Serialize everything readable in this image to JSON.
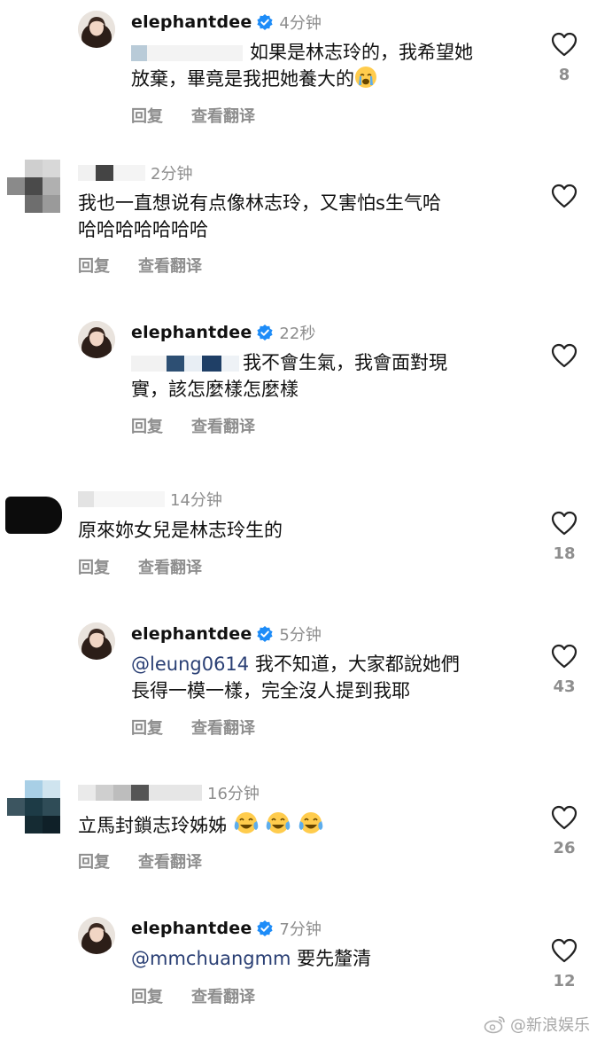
{
  "comments": [
    {
      "username": "elephantdee",
      "time": "4分钟",
      "text_line1": "如果是林志玲的，我希望她",
      "text_line2": "放棄，畢竟是我把她養大的",
      "reply": "回复",
      "translate": "查看翻译",
      "likes": "8"
    },
    {
      "username": "",
      "time": "2分钟",
      "text_line1": "我也一直想说有点像林志玲，又害怕s生气哈",
      "text_line2": "哈哈哈哈哈哈哈",
      "reply": "回复",
      "translate": "查看翻译",
      "likes": ""
    },
    {
      "username": "elephantdee",
      "time": "22秒",
      "text_line1": "我不會生氣，我會面對現",
      "text_line2": "實，該怎麼樣怎麼樣",
      "reply": "回复",
      "translate": "查看翻译",
      "likes": ""
    },
    {
      "username": "",
      "time": "14分钟",
      "text_line1": "原來妳女兒是林志玲生的",
      "reply": "回复",
      "translate": "查看翻译",
      "likes": "18"
    },
    {
      "username": "elephantdee",
      "time": "5分钟",
      "mention": "@leung0614",
      "text_line1": " 我不知道，大家都說她們",
      "text_line2": "長得一模一樣，完全沒人提到我耶",
      "reply": "回复",
      "translate": "查看翻译",
      "likes": "43"
    },
    {
      "username": "",
      "time": "16分钟",
      "text_line1": "立馬封鎖志玲姊姊",
      "reply": "回复",
      "translate": "查看翻译",
      "likes": "26"
    },
    {
      "username": "elephantdee",
      "time": "7分钟",
      "mention": "@mmchuangmm",
      "text_line1": " 要先釐清",
      "reply": "回复",
      "translate": "查看翻译",
      "likes": "12"
    }
  ],
  "watermark": "@新浪娱乐",
  "colors": {
    "text": "#111111",
    "muted": "#8e8e8e",
    "verified": "#1d8cf8",
    "mention": "#2a3f74"
  }
}
